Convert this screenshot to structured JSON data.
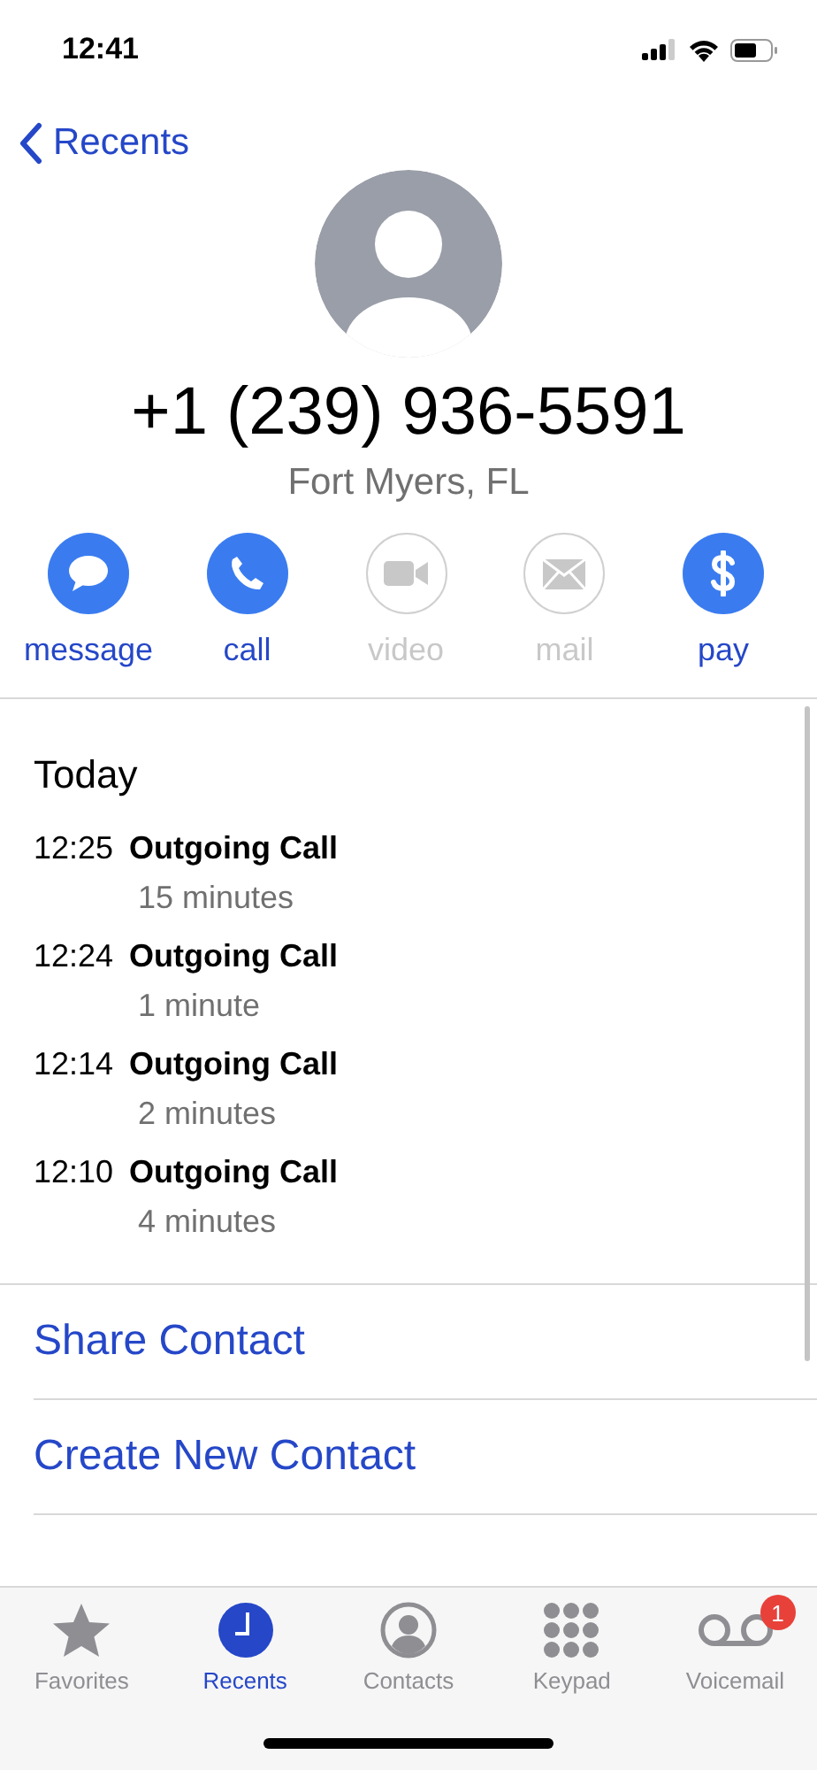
{
  "status_bar": {
    "time": "12:41"
  },
  "nav": {
    "back_label": "Recents"
  },
  "contact": {
    "phone": "+1 (239) 936-5591",
    "location": "Fort Myers, FL"
  },
  "actions": [
    {
      "kind": "message",
      "label": "message",
      "disabled": false
    },
    {
      "kind": "call",
      "label": "call",
      "disabled": false
    },
    {
      "kind": "video",
      "label": "video",
      "disabled": true
    },
    {
      "kind": "mail",
      "label": "mail",
      "disabled": true
    },
    {
      "kind": "pay",
      "label": "pay",
      "disabled": false
    }
  ],
  "history": {
    "heading": "Today",
    "calls": [
      {
        "time": "12:25",
        "type": "Outgoing Call",
        "duration": "15 minutes"
      },
      {
        "time": "12:24",
        "type": "Outgoing Call",
        "duration": "1 minute"
      },
      {
        "time": "12:14",
        "type": "Outgoing Call",
        "duration": "2 minutes"
      },
      {
        "time": "12:10",
        "type": "Outgoing Call",
        "duration": "4 minutes"
      }
    ]
  },
  "links": [
    "Share Contact",
    "Create New Contact"
  ],
  "tab_bar": [
    {
      "kind": "favorites",
      "label": "Favorites",
      "selected": false
    },
    {
      "kind": "recents",
      "label": "Recents",
      "selected": true
    },
    {
      "kind": "contacts",
      "label": "Contacts",
      "selected": false
    },
    {
      "kind": "keypad",
      "label": "Keypad",
      "selected": false
    },
    {
      "kind": "voicemail",
      "label": "Voicemail",
      "selected": false,
      "badge": "1"
    }
  ]
}
